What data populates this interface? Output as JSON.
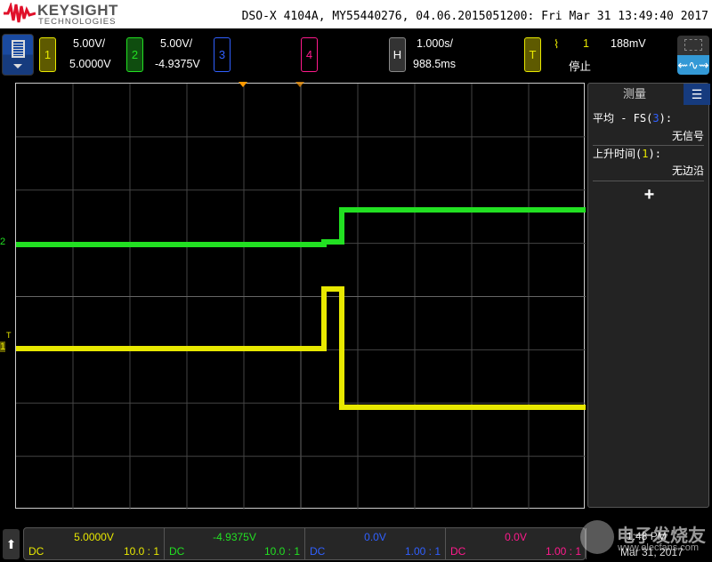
{
  "header": {
    "brand": "KEYSIGHT",
    "brand_sub": "TECHNOLOGIES",
    "title": "DSO-X 4104A, MY55440276, 04.06.2015051200: Fri Mar 31 13:49:40 2017"
  },
  "channels": [
    {
      "num": "1",
      "scale": "5.00V/",
      "offset": "5.0000V",
      "color": "#e8e800"
    },
    {
      "num": "2",
      "scale": "5.00V/",
      "offset": "-4.9375V",
      "color": "#22e022"
    },
    {
      "num": "3",
      "color": "#3060ff"
    },
    {
      "num": "4",
      "color": "#ff1a8c"
    }
  ],
  "horizontal": {
    "label": "H",
    "scale": "1.000s/",
    "delay": "988.5ms"
  },
  "trigger": {
    "label": "T",
    "source": "1",
    "level": "188mV",
    "status": "停止"
  },
  "measure_panel": {
    "title": "测量",
    "items": [
      {
        "label_pre": "平均 - FS(",
        "ch": "3",
        "label_post": "):",
        "value": "无信号"
      },
      {
        "label_pre": "上升时间(",
        "ch": "1",
        "label_post": "):",
        "value": "无边沿"
      }
    ],
    "add": "+"
  },
  "markers": {
    "ch1": "1",
    "ch2": "2",
    "trig": "T"
  },
  "bottom": [
    {
      "value": "5.0000V",
      "coupling": "DC",
      "ratio": "10.0 : 1"
    },
    {
      "value": "-4.9375V",
      "coupling": "DC",
      "ratio": "10.0 : 1"
    },
    {
      "value": "0.0V",
      "coupling": "DC",
      "ratio": "1.00 : 1"
    },
    {
      "value": "0.0V",
      "coupling": "DC",
      "ratio": "1.00 : 1"
    }
  ],
  "clock": {
    "time": "1:48 PM",
    "date": "Mar 31, 2017"
  },
  "watermark": {
    "text": "电子发烧友",
    "url": "www.elecfans.com"
  }
}
